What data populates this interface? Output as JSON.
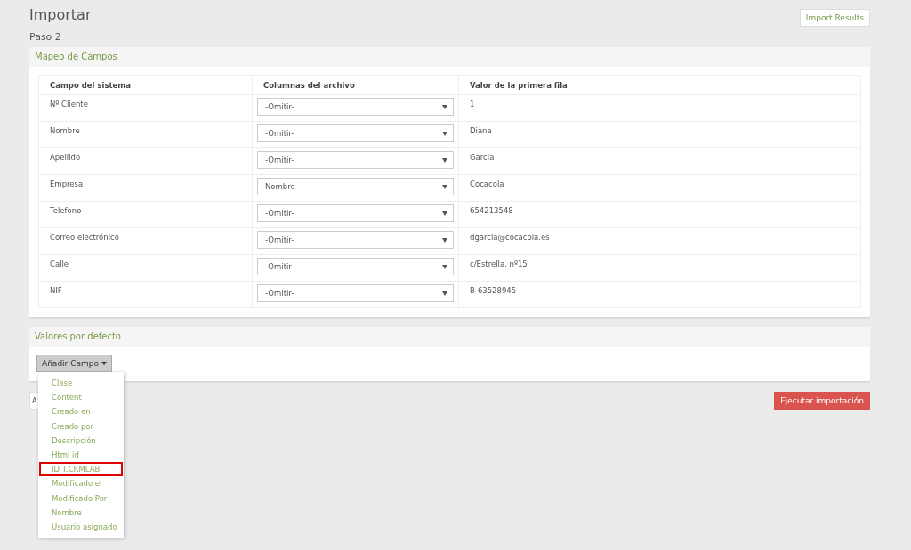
{
  "title": "Importar",
  "import_results_button": "Import Results",
  "step": "Paso 2",
  "mapping_panel": {
    "title": "Mapeo de Campos",
    "columns": [
      "Campo del sistema",
      "Columnas del archivo",
      "Valor de la primera fila"
    ],
    "rows": [
      {
        "field": "Nº Cliente",
        "column": "-Omitir-",
        "value": "1"
      },
      {
        "field": "Nombre",
        "column": "-Omitir-",
        "value": "Diana"
      },
      {
        "field": "Apellido",
        "column": "-Omitir-",
        "value": "Garcia"
      },
      {
        "field": "Empresa",
        "column": "Nombre",
        "value": "Cocacola"
      },
      {
        "field": "Telefono",
        "column": "-Omitir-",
        "value": "654213548"
      },
      {
        "field": "Correo electrónico",
        "column": "-Omitir-",
        "value": "dgarcia@cocacola.es"
      },
      {
        "field": "Calle",
        "column": "-Omitir-",
        "value": "c/Estrella, nº15"
      },
      {
        "field": "NIF",
        "column": "-Omitir-",
        "value": "B-63528945"
      }
    ]
  },
  "defaults_panel": {
    "title": "Valores por defecto",
    "add_field_button": "Añadir Campo",
    "menu": [
      {
        "label": "Clase",
        "highlighted": false
      },
      {
        "label": "Content",
        "highlighted": false
      },
      {
        "label": "Creado en",
        "highlighted": false
      },
      {
        "label": "Creado por",
        "highlighted": false
      },
      {
        "label": "Descripción",
        "highlighted": false
      },
      {
        "label": "Html id",
        "highlighted": false
      },
      {
        "label": "ID T.CRMLAB",
        "highlighted": true
      },
      {
        "label": "Modificado el",
        "highlighted": false
      },
      {
        "label": "Modificado Por",
        "highlighted": false
      },
      {
        "label": "Nombre",
        "highlighted": false
      },
      {
        "label": "Usuario asignado",
        "highlighted": false
      }
    ]
  },
  "back_button": "A",
  "run_button": "Ejecutar importación"
}
